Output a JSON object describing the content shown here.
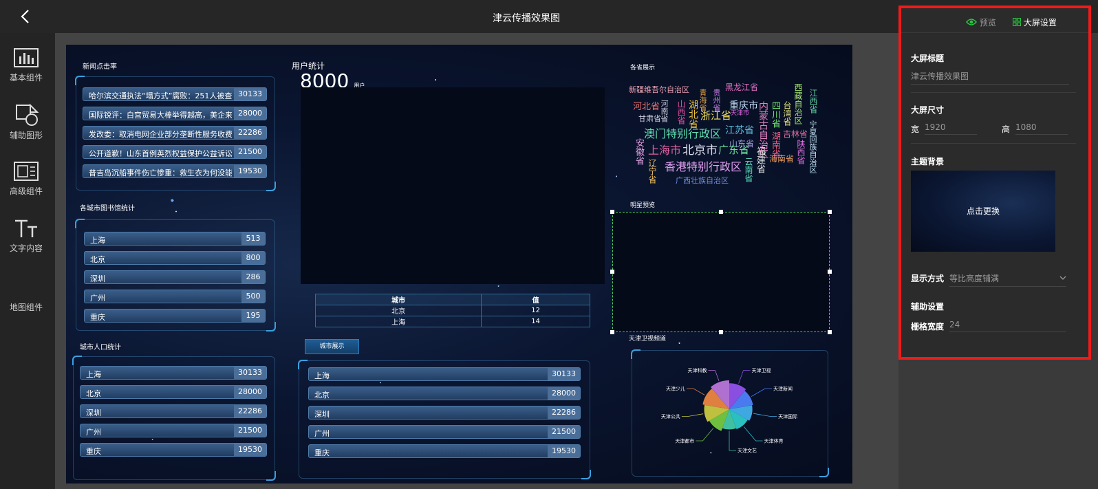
{
  "window": {
    "title": "津云传播效果图"
  },
  "colors": {
    "accent_green": "#28c840",
    "highlight_red": "#ef1a1a",
    "selection_green": "#4ccf60"
  },
  "icons": {
    "back": "chevron-left-icon",
    "preview": "eye-icon",
    "settings": "grid-icon"
  },
  "sidebar": {
    "items": [
      {
        "label": "基本组件",
        "icon": "bar-chart-icon"
      },
      {
        "label": "辅助图形",
        "icon": "shapes-icon"
      },
      {
        "label": "高级组件",
        "icon": "panel-icon"
      },
      {
        "label": "文字内容",
        "icon": "text-icon"
      },
      {
        "label": "地图组件",
        "icon": ""
      }
    ]
  },
  "screen": {
    "news": {
      "title": "新闻点击率",
      "rows": [
        {
          "label": "哈尔滨交通执法“塌方式”腐败：251人被查...",
          "value": "30133"
        },
        {
          "label": "国际锐评：白宫贸易大棒举得越高，美企来...",
          "value": "28000"
        },
        {
          "label": "发改委：取消电网企业部分垄断性服务收费...",
          "value": "22286"
        },
        {
          "label": "公开道歉！山东首例英烈权益保护公益诉讼...",
          "value": "21500"
        },
        {
          "label": "普吉岛沉船事件伤亡惨重：救生衣为何没能...",
          "value": "19530"
        }
      ]
    },
    "library": {
      "title": "各城市图书馆统计",
      "rows": [
        {
          "label": "上海",
          "value": "513"
        },
        {
          "label": "北京",
          "value": "800"
        },
        {
          "label": "深圳",
          "value": "286"
        },
        {
          "label": "广州",
          "value": "500"
        },
        {
          "label": "重庆",
          "value": "195"
        }
      ]
    },
    "population": {
      "title": "城市人口统计",
      "rows": [
        {
          "label": "上海",
          "value": "30133"
        },
        {
          "label": "北京",
          "value": "28000"
        },
        {
          "label": "深圳",
          "value": "22286"
        },
        {
          "label": "广州",
          "value": "21500"
        },
        {
          "label": "重庆",
          "value": "19530"
        }
      ]
    },
    "users": {
      "title": "用户统计",
      "count": "8000",
      "unit": "用户"
    },
    "city_table": {
      "headers": [
        "城市",
        "值"
      ],
      "rows": [
        [
          "北京",
          "12"
        ],
        [
          "上海",
          "14"
        ]
      ]
    },
    "city_display": {
      "button": "城市展示",
      "rows": [
        {
          "label": "上海",
          "value": "30133"
        },
        {
          "label": "北京",
          "value": "28000"
        },
        {
          "label": "深圳",
          "value": "22286"
        },
        {
          "label": "广州",
          "value": "21500"
        },
        {
          "label": "重庆",
          "value": "19530"
        }
      ]
    },
    "provinces": {
      "title": "各省展示",
      "words": [
        {
          "text": "新疆维吾尔自治区",
          "color": "#e8a0b0"
        },
        {
          "text": "黑龙江省",
          "color": "#e070c0"
        },
        {
          "text": "西藏自治区",
          "color": "#a0e070"
        },
        {
          "text": "江西省",
          "color": "#60d0a0"
        },
        {
          "text": "青海省",
          "color": "#e0a040"
        },
        {
          "text": "贵州省",
          "color": "#c080e0"
        },
        {
          "text": "河北省",
          "color": "#e87070"
        },
        {
          "text": "河南省",
          "color": "#d0d0e0"
        },
        {
          "text": "山西省",
          "color": "#e050a0"
        },
        {
          "text": "湖北省",
          "color": "#e8c040"
        },
        {
          "text": "浙江省",
          "color": "#f0e060"
        },
        {
          "text": "重庆市",
          "color": "#c0d8f0"
        },
        {
          "text": "天津市",
          "color": "#e060e0"
        },
        {
          "text": "四川省",
          "color": "#70e070"
        },
        {
          "text": "台湾省",
          "color": "#e0e080"
        },
        {
          "text": "甘肃省",
          "color": "#d0d0e0"
        },
        {
          "text": "内蒙古自治区",
          "color": "#e080c0"
        },
        {
          "text": "吉林省",
          "color": "#e070a0"
        },
        {
          "text": "宁夏回族自治区",
          "color": "#c0e0f0"
        },
        {
          "text": "澳门特别行政区",
          "color": "#60e0b0"
        },
        {
          "text": "江苏省",
          "color": "#60c0e0"
        },
        {
          "text": "湖南省",
          "color": "#e06080"
        },
        {
          "text": "山东省",
          "color": "#a0a0e0"
        },
        {
          "text": "福建省",
          "color": "#e0e0e0"
        },
        {
          "text": "陕西省",
          "color": "#e070e0"
        },
        {
          "text": "安徽省",
          "color": "#e0a0e0"
        },
        {
          "text": "上海市",
          "color": "#e060a0"
        },
        {
          "text": "北京市",
          "color": "#e0e0f0"
        },
        {
          "text": "广东省",
          "color": "#70e0a0"
        },
        {
          "text": "海南省",
          "color": "#f0a060"
        },
        {
          "text": "辽宁省",
          "color": "#f0c060"
        },
        {
          "text": "香港特别行政区",
          "color": "#e0a0f0"
        },
        {
          "text": "云南省",
          "color": "#60e0c0"
        },
        {
          "text": "广西壮族自治区",
          "color": "#7090e0"
        }
      ]
    },
    "stars": {
      "title": "明星预览"
    },
    "tianjin": {
      "title": "天津卫视频道",
      "chart_data": {
        "type": "pie",
        "rose": true,
        "categories": [
          "天津卫视",
          "天津新闻",
          "天津国际",
          "天津体育",
          "天津文艺",
          "天津都市",
          "天津公共",
          "天津少儿",
          "天津科教"
        ],
        "values": [
          40,
          36,
          34,
          30,
          28,
          34,
          38,
          42,
          46
        ],
        "colors": [
          "#8a4ee0",
          "#4a7af0",
          "#40a8e0",
          "#2ac0c0",
          "#40c0a0",
          "#70c040",
          "#c0c040",
          "#e08040",
          "#b070d0"
        ]
      }
    }
  },
  "settings_panel": {
    "preview_label": "预览",
    "settings_label": "大屏设置",
    "title_label": "大屏标题",
    "title_value": "津云传播效果图",
    "size_label": "大屏尺寸",
    "width_label": "宽",
    "width_value": "1920",
    "height_label": "高",
    "height_value": "1080",
    "bg_label": "主题背景",
    "bg_click": "点击更换",
    "display_label": "显示方式",
    "display_value": "等比高度铺满",
    "aux_label": "辅助设置",
    "grid_label": "栅格宽度",
    "grid_value": "24"
  }
}
